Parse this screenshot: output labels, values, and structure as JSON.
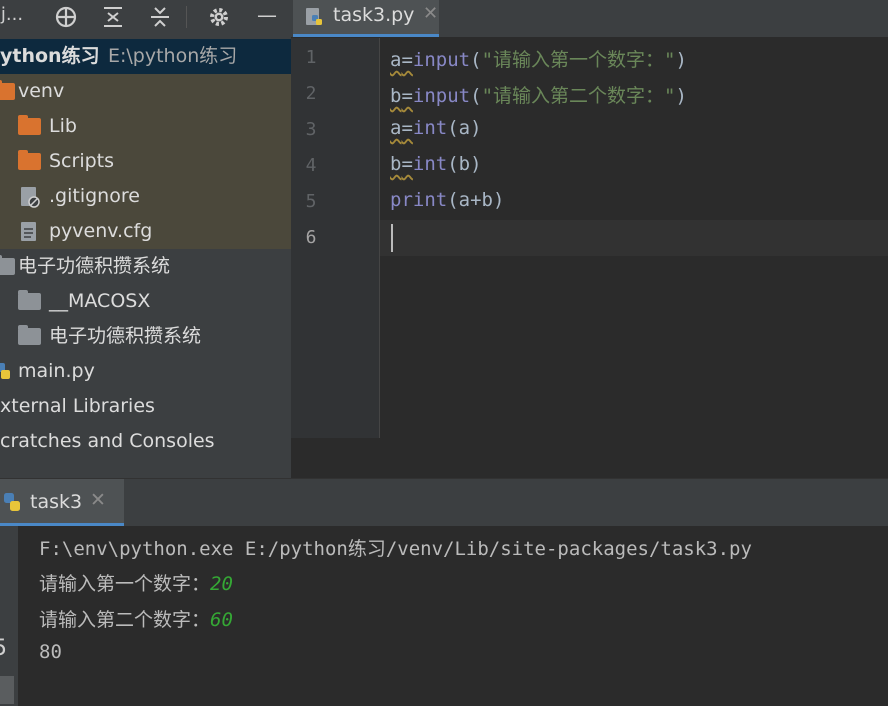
{
  "project_panel": {
    "toolbar": {
      "project_name_truncated": "j...",
      "close_label": "—"
    },
    "tree": [
      {
        "label": "ython练习",
        "sub": "E:\\python练习"
      },
      {
        "label": "venv"
      },
      {
        "label": "Lib"
      },
      {
        "label": "Scripts"
      },
      {
        "label": ".gitignore"
      },
      {
        "label": "pyvenv.cfg"
      },
      {
        "label": "电子功德积攒系统"
      },
      {
        "label": "__MACOSX"
      },
      {
        "label": "电子功德积攒系统"
      },
      {
        "label": "main.py"
      },
      {
        "label": "xternal Libraries"
      },
      {
        "label": "cratches and Consoles"
      }
    ]
  },
  "editor": {
    "tab": {
      "label": "task3.py",
      "close": "✕"
    },
    "line_numbers": [
      "1",
      "2",
      "3",
      "4",
      "5",
      "6"
    ],
    "lines": [
      {
        "var": "a",
        "eq": "=",
        "fn": "input",
        "open": "(",
        "str": "\"请输入第一个数字：\"",
        "close": ")"
      },
      {
        "var": "b",
        "eq": "=",
        "fn": "input",
        "open": "(",
        "str": "\"请输入第二个数字：\"",
        "close": ")"
      },
      {
        "var": "a",
        "eq": "=",
        "fn": "int",
        "args": "(a)"
      },
      {
        "var": "b",
        "eq": "=",
        "fn": "int",
        "args": "(b)"
      },
      {
        "fn": "print",
        "args": "(a+b)"
      }
    ]
  },
  "run_panel": {
    "tab": {
      "label": "task3",
      "close": "✕"
    },
    "side_fragment": "5",
    "console": {
      "command": "F:\\env\\python.exe E:/python练习/venv/Lib/site-packages/task3.py",
      "prompt1": "请输入第一个数字：",
      "input1": "20",
      "prompt2": "请输入第二个数字：",
      "input2": "60",
      "result": "80"
    }
  },
  "colors": {
    "accent": "#4a88c7",
    "folder": "#d9732f",
    "folder_gray": "#8d9297",
    "selected": "#0d293e",
    "venv_bg": "#4b483b"
  }
}
